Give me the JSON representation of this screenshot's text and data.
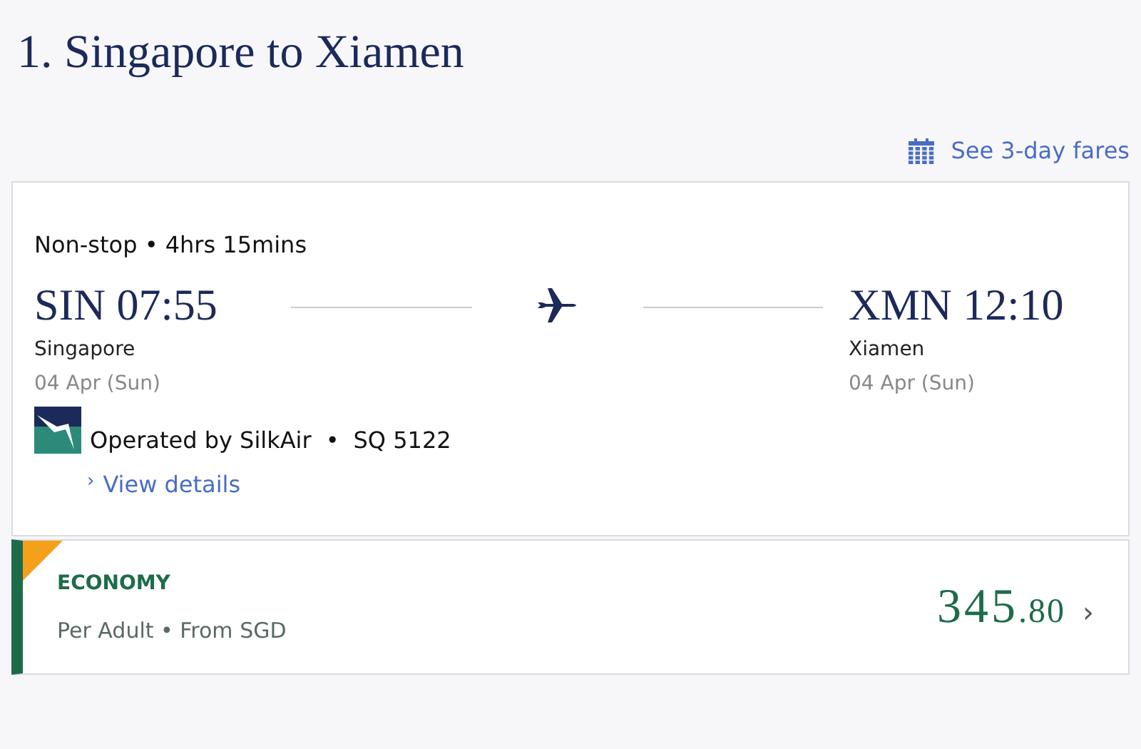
{
  "heading": "1. Singapore to Xiamen",
  "fares_link": {
    "label": "See 3-day fares"
  },
  "flight": {
    "summary": "Non-stop • 4hrs 15mins",
    "departure": {
      "code_time": "SIN 07:55",
      "city": "Singapore",
      "date": "04 Apr (Sun)"
    },
    "arrival": {
      "code_time": "XMN 12:10",
      "city": "Xiamen",
      "date": "04 Apr (Sun)"
    },
    "operator": "Operated by SilkAir",
    "separator": "•",
    "flight_number": "SQ 5122",
    "details_link": {
      "chevron": "›",
      "label": "View details"
    }
  },
  "fare": {
    "cabin": "ECONOMY",
    "basis": "Per Adult • From SGD",
    "price_whole": "345",
    "price_decimal": ".80",
    "chevron": "›",
    "selected": true
  }
}
